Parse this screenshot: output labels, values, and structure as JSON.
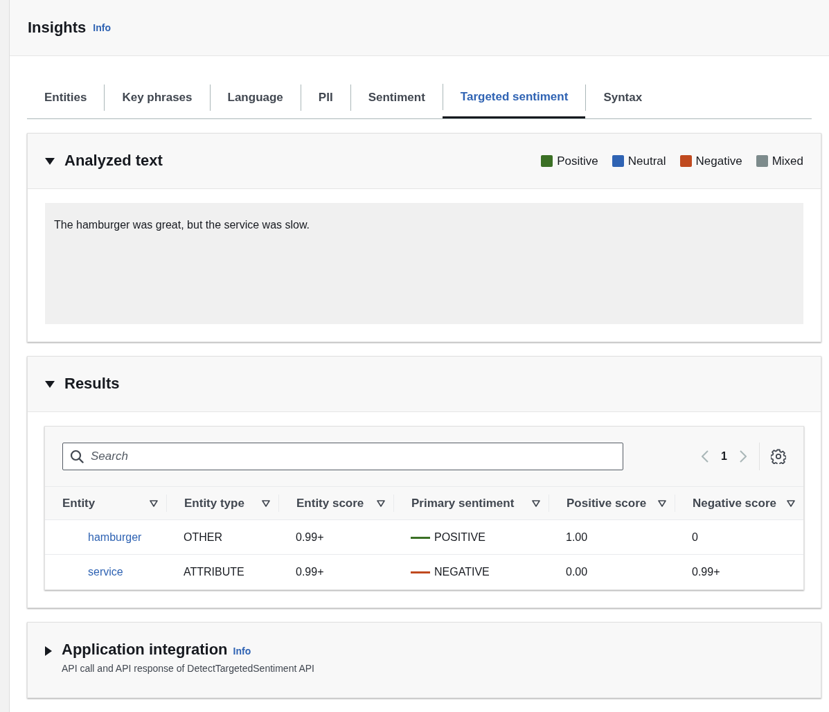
{
  "header": {
    "title": "Insights",
    "info": "Info"
  },
  "tabs": [
    {
      "label": "Entities",
      "selected": false
    },
    {
      "label": "Key phrases",
      "selected": false
    },
    {
      "label": "Language",
      "selected": false
    },
    {
      "label": "PII",
      "selected": false
    },
    {
      "label": "Sentiment",
      "selected": false
    },
    {
      "label": "Targeted sentiment",
      "selected": true
    },
    {
      "label": "Syntax",
      "selected": false
    }
  ],
  "analyzed_text": {
    "title": "Analyzed text",
    "expanded": true,
    "legend": [
      {
        "label": "Positive",
        "color": "#3b7025"
      },
      {
        "label": "Neutral",
        "color": "#2f63b3"
      },
      {
        "label": "Negative",
        "color": "#c04a1f"
      },
      {
        "label": "Mixed",
        "color": "#7d8b8c"
      }
    ],
    "text": "The hamburger was great, but the service was slow."
  },
  "results": {
    "title": "Results",
    "expanded": true,
    "search": {
      "placeholder": "Search"
    },
    "pagination": {
      "page": "1"
    },
    "table": {
      "columns": [
        "Entity",
        "Entity type",
        "Entity score",
        "Primary sentiment",
        "Positive score",
        "Negative score"
      ],
      "rows": [
        {
          "entity": "hamburger",
          "entity_type": "OTHER",
          "entity_score": "0.99+",
          "sentiment": "POSITIVE",
          "color": "#3b7025",
          "positive_score": "1.00",
          "negative_score": "0"
        },
        {
          "entity": "service",
          "entity_type": "ATTRIBUTE",
          "entity_score": "0.99+",
          "sentiment": "NEGATIVE",
          "color": "#c04a1f",
          "positive_score": "0.00",
          "negative_score": "0.99+"
        }
      ]
    }
  },
  "application_integration": {
    "title": "Application integration",
    "info": "Info",
    "expanded": false,
    "description": "API call and API response of DetectTargetedSentiment API"
  }
}
